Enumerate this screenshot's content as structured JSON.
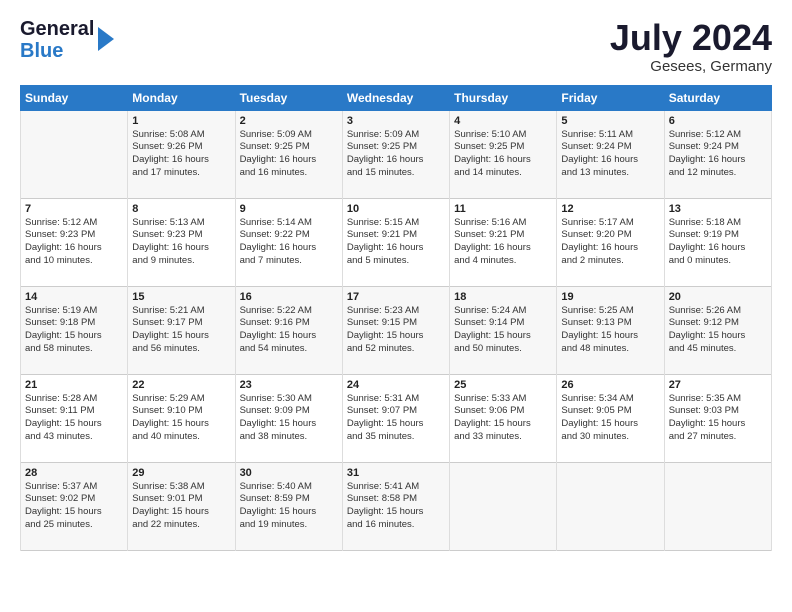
{
  "logo": {
    "line1": "General",
    "line2": "Blue"
  },
  "title": {
    "month_year": "July 2024",
    "location": "Gesees, Germany"
  },
  "days_of_week": [
    "Sunday",
    "Monday",
    "Tuesday",
    "Wednesday",
    "Thursday",
    "Friday",
    "Saturday"
  ],
  "weeks": [
    [
      {
        "day": "",
        "text": ""
      },
      {
        "day": "1",
        "text": "Sunrise: 5:08 AM\nSunset: 9:26 PM\nDaylight: 16 hours\nand 17 minutes."
      },
      {
        "day": "2",
        "text": "Sunrise: 5:09 AM\nSunset: 9:25 PM\nDaylight: 16 hours\nand 16 minutes."
      },
      {
        "day": "3",
        "text": "Sunrise: 5:09 AM\nSunset: 9:25 PM\nDaylight: 16 hours\nand 15 minutes."
      },
      {
        "day": "4",
        "text": "Sunrise: 5:10 AM\nSunset: 9:25 PM\nDaylight: 16 hours\nand 14 minutes."
      },
      {
        "day": "5",
        "text": "Sunrise: 5:11 AM\nSunset: 9:24 PM\nDaylight: 16 hours\nand 13 minutes."
      },
      {
        "day": "6",
        "text": "Sunrise: 5:12 AM\nSunset: 9:24 PM\nDaylight: 16 hours\nand 12 minutes."
      }
    ],
    [
      {
        "day": "7",
        "text": "Sunrise: 5:12 AM\nSunset: 9:23 PM\nDaylight: 16 hours\nand 10 minutes."
      },
      {
        "day": "8",
        "text": "Sunrise: 5:13 AM\nSunset: 9:23 PM\nDaylight: 16 hours\nand 9 minutes."
      },
      {
        "day": "9",
        "text": "Sunrise: 5:14 AM\nSunset: 9:22 PM\nDaylight: 16 hours\nand 7 minutes."
      },
      {
        "day": "10",
        "text": "Sunrise: 5:15 AM\nSunset: 9:21 PM\nDaylight: 16 hours\nand 5 minutes."
      },
      {
        "day": "11",
        "text": "Sunrise: 5:16 AM\nSunset: 9:21 PM\nDaylight: 16 hours\nand 4 minutes."
      },
      {
        "day": "12",
        "text": "Sunrise: 5:17 AM\nSunset: 9:20 PM\nDaylight: 16 hours\nand 2 minutes."
      },
      {
        "day": "13",
        "text": "Sunrise: 5:18 AM\nSunset: 9:19 PM\nDaylight: 16 hours\nand 0 minutes."
      }
    ],
    [
      {
        "day": "14",
        "text": "Sunrise: 5:19 AM\nSunset: 9:18 PM\nDaylight: 15 hours\nand 58 minutes."
      },
      {
        "day": "15",
        "text": "Sunrise: 5:21 AM\nSunset: 9:17 PM\nDaylight: 15 hours\nand 56 minutes."
      },
      {
        "day": "16",
        "text": "Sunrise: 5:22 AM\nSunset: 9:16 PM\nDaylight: 15 hours\nand 54 minutes."
      },
      {
        "day": "17",
        "text": "Sunrise: 5:23 AM\nSunset: 9:15 PM\nDaylight: 15 hours\nand 52 minutes."
      },
      {
        "day": "18",
        "text": "Sunrise: 5:24 AM\nSunset: 9:14 PM\nDaylight: 15 hours\nand 50 minutes."
      },
      {
        "day": "19",
        "text": "Sunrise: 5:25 AM\nSunset: 9:13 PM\nDaylight: 15 hours\nand 48 minutes."
      },
      {
        "day": "20",
        "text": "Sunrise: 5:26 AM\nSunset: 9:12 PM\nDaylight: 15 hours\nand 45 minutes."
      }
    ],
    [
      {
        "day": "21",
        "text": "Sunrise: 5:28 AM\nSunset: 9:11 PM\nDaylight: 15 hours\nand 43 minutes."
      },
      {
        "day": "22",
        "text": "Sunrise: 5:29 AM\nSunset: 9:10 PM\nDaylight: 15 hours\nand 40 minutes."
      },
      {
        "day": "23",
        "text": "Sunrise: 5:30 AM\nSunset: 9:09 PM\nDaylight: 15 hours\nand 38 minutes."
      },
      {
        "day": "24",
        "text": "Sunrise: 5:31 AM\nSunset: 9:07 PM\nDaylight: 15 hours\nand 35 minutes."
      },
      {
        "day": "25",
        "text": "Sunrise: 5:33 AM\nSunset: 9:06 PM\nDaylight: 15 hours\nand 33 minutes."
      },
      {
        "day": "26",
        "text": "Sunrise: 5:34 AM\nSunset: 9:05 PM\nDaylight: 15 hours\nand 30 minutes."
      },
      {
        "day": "27",
        "text": "Sunrise: 5:35 AM\nSunset: 9:03 PM\nDaylight: 15 hours\nand 27 minutes."
      }
    ],
    [
      {
        "day": "28",
        "text": "Sunrise: 5:37 AM\nSunset: 9:02 PM\nDaylight: 15 hours\nand 25 minutes."
      },
      {
        "day": "29",
        "text": "Sunrise: 5:38 AM\nSunset: 9:01 PM\nDaylight: 15 hours\nand 22 minutes."
      },
      {
        "day": "30",
        "text": "Sunrise: 5:40 AM\nSunset: 8:59 PM\nDaylight: 15 hours\nand 19 minutes."
      },
      {
        "day": "31",
        "text": "Sunrise: 5:41 AM\nSunset: 8:58 PM\nDaylight: 15 hours\nand 16 minutes."
      },
      {
        "day": "",
        "text": ""
      },
      {
        "day": "",
        "text": ""
      },
      {
        "day": "",
        "text": ""
      }
    ]
  ]
}
